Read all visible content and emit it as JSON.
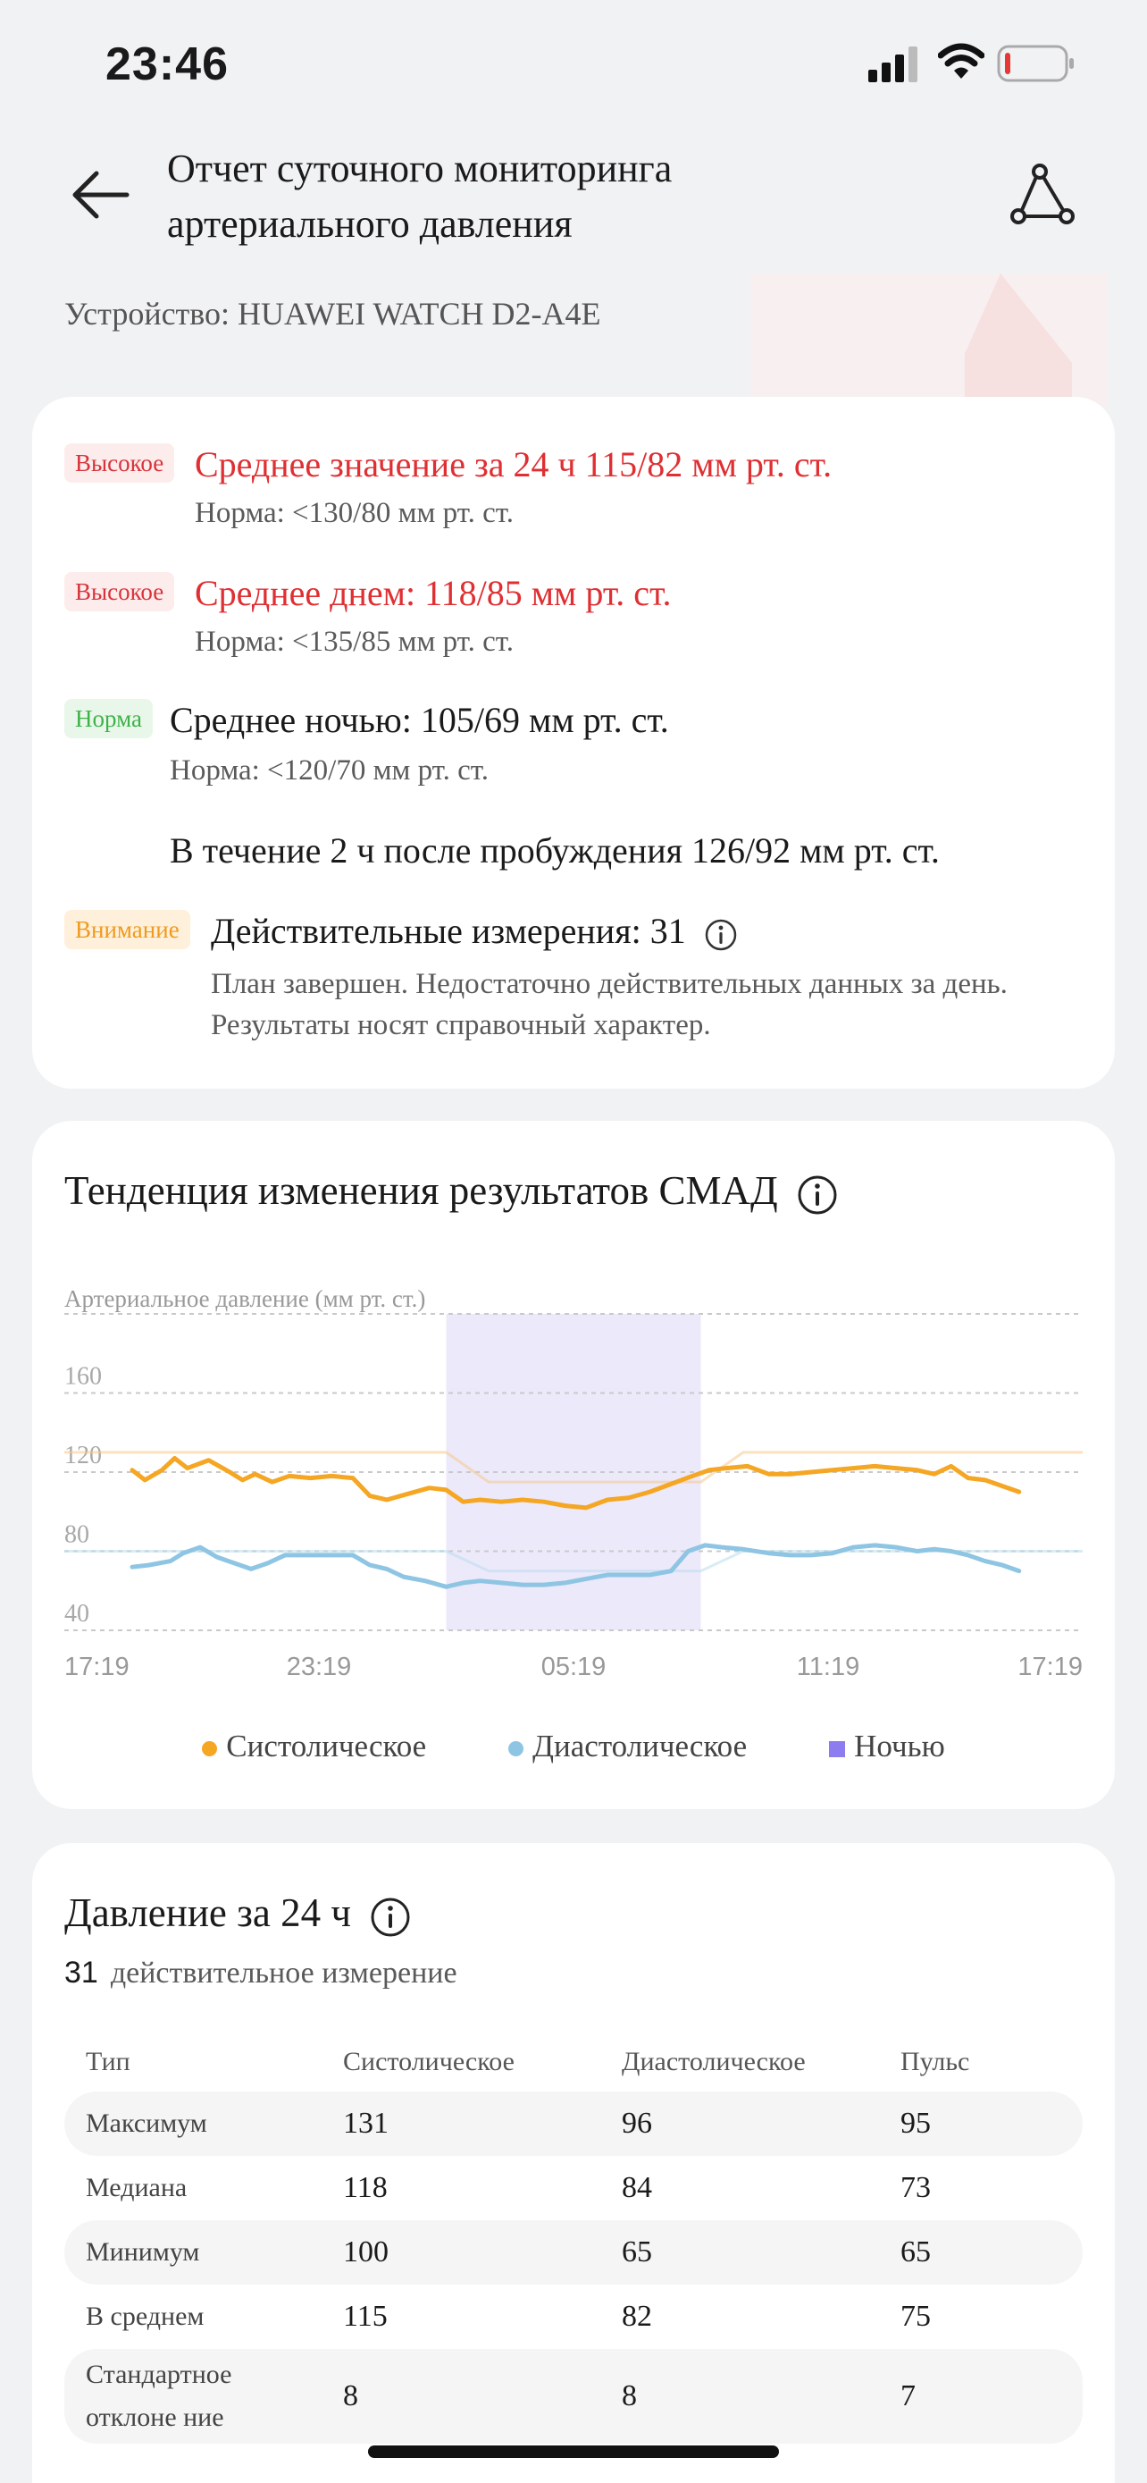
{
  "status_bar": {
    "time": "23:46"
  },
  "header": {
    "title_line1": "Отчет суточного мониторинга",
    "title_line2": "артериального давления",
    "device": "Устройство: HUAWEI WATCH D2-A4E"
  },
  "summary": {
    "rows": [
      {
        "badge": "Высокое",
        "main": "Среднее значение за 24 ч 115/82 мм рт. ст.",
        "norm": "Норма: <130/80 мм рт. ст."
      },
      {
        "badge": "Высокое",
        "main": "Среднее днем: 118/85 мм рт. ст.",
        "norm": "Норма: <135/85 мм рт. ст."
      },
      {
        "badge": "Норма",
        "main": "Среднее ночью: 105/69 мм рт. ст.",
        "norm": "Норма: <120/70 мм рт. ст."
      }
    ],
    "wake": "В течение 2 ч после пробуждения 126/92 мм рт. ст.",
    "valid": {
      "badge": "Внимание",
      "main": "Действительные измерения: 31",
      "note1": "План завершен. Недостаточно действительных данных за день.",
      "note2": "Результаты носят справочный характер."
    },
    "colors": {
      "high": "#e02f32",
      "normal": "#3fb24a",
      "warning": "#f09a1c"
    }
  },
  "trend": {
    "title": "Тенденция изменения результатов СМАД",
    "legend": {
      "systolic": "Систолическое",
      "diastolic": "Диастолическое",
      "night": "Ночью"
    }
  },
  "chart_data": {
    "type": "line",
    "ylabel": "Артериальное давление (мм рт. ст.)",
    "ylim": [
      40,
      160
    ],
    "yticks": [
      40,
      80,
      120,
      160
    ],
    "xticks": [
      "17:19",
      "23:19",
      "05:19",
      "11:19",
      "17:19"
    ],
    "x_hours_from_start": [
      0,
      6,
      12,
      18,
      24
    ],
    "night_range_hours": [
      9,
      15
    ],
    "thresholds": {
      "systolic": [
        [
          0,
          130
        ],
        [
          9,
          130
        ],
        [
          10,
          115
        ],
        [
          15,
          115
        ],
        [
          16,
          130
        ],
        [
          24,
          130
        ]
      ],
      "diastolic": [
        [
          0,
          80
        ],
        [
          9,
          80
        ],
        [
          10,
          70
        ],
        [
          15,
          70
        ],
        [
          16,
          80
        ],
        [
          24,
          80
        ]
      ]
    },
    "series": [
      {
        "name": "Систолическое",
        "color": "#f5a623",
        "x": [
          1.6,
          1.9,
          2.3,
          2.6,
          2.9,
          3.4,
          3.9,
          4.2,
          4.5,
          4.9,
          5.3,
          5.8,
          6.3,
          6.8,
          7.2,
          7.6,
          8.1,
          8.6,
          9.0,
          9.4,
          9.8,
          10.3,
          10.8,
          11.3,
          11.8,
          12.3,
          12.8,
          13.3,
          13.8,
          14.3,
          14.8,
          15.2,
          15.6,
          16.1,
          16.6,
          17.1,
          17.6,
          18.1,
          18.6,
          19.1,
          19.6,
          20.1,
          20.5,
          20.9,
          21.3,
          21.7,
          22.1,
          22.5
        ],
        "y": [
          121,
          116,
          121,
          127,
          122,
          126,
          120,
          116,
          119,
          115,
          118,
          117,
          118,
          117,
          108,
          106,
          109,
          112,
          111,
          105,
          106,
          105,
          106,
          105,
          103,
          102,
          106,
          107,
          110,
          114,
          118,
          121,
          122,
          123,
          119,
          119,
          120,
          121,
          122,
          123,
          122,
          121,
          119,
          123,
          117,
          116,
          113,
          110
        ]
      },
      {
        "name": "Диастолическое",
        "color": "#8ec5e3",
        "x": [
          1.6,
          2.0,
          2.5,
          2.8,
          3.2,
          3.6,
          4.0,
          4.4,
          4.8,
          5.2,
          5.7,
          6.2,
          6.8,
          7.2,
          7.6,
          8.0,
          8.5,
          9.0,
          9.4,
          9.8,
          10.3,
          10.8,
          11.3,
          11.8,
          12.3,
          12.8,
          13.3,
          13.8,
          14.3,
          14.7,
          15.1,
          15.5,
          16.0,
          16.6,
          17.1,
          17.6,
          18.1,
          18.6,
          19.1,
          19.6,
          20.1,
          20.5,
          20.9,
          21.3,
          21.7,
          22.1,
          22.5
        ],
        "y": [
          72,
          73,
          75,
          79,
          82,
          77,
          74,
          71,
          74,
          78,
          78,
          78,
          78,
          73,
          71,
          67,
          65,
          62,
          64,
          65,
          64,
          63,
          63,
          64,
          66,
          68,
          68,
          68,
          70,
          80,
          83,
          82,
          81,
          79,
          78,
          78,
          79,
          82,
          83,
          82,
          80,
          81,
          80,
          78,
          75,
          73,
          70
        ]
      }
    ]
  },
  "day_table": {
    "title": "Давление за 24 ч",
    "count_value": "31",
    "count_text": "действительное измерение",
    "headers": [
      "Тип",
      "Систолическое",
      "Диастолическое",
      "Пульс"
    ],
    "rows": [
      [
        "Максимум",
        "131",
        "96",
        "95"
      ],
      [
        "Медиана",
        "118",
        "84",
        "73"
      ],
      [
        "Минимум",
        "100",
        "65",
        "65"
      ],
      [
        "В среднем",
        "115",
        "82",
        "75"
      ],
      [
        "Стандартное отклоне ние",
        "8",
        "8",
        "7"
      ]
    ]
  }
}
